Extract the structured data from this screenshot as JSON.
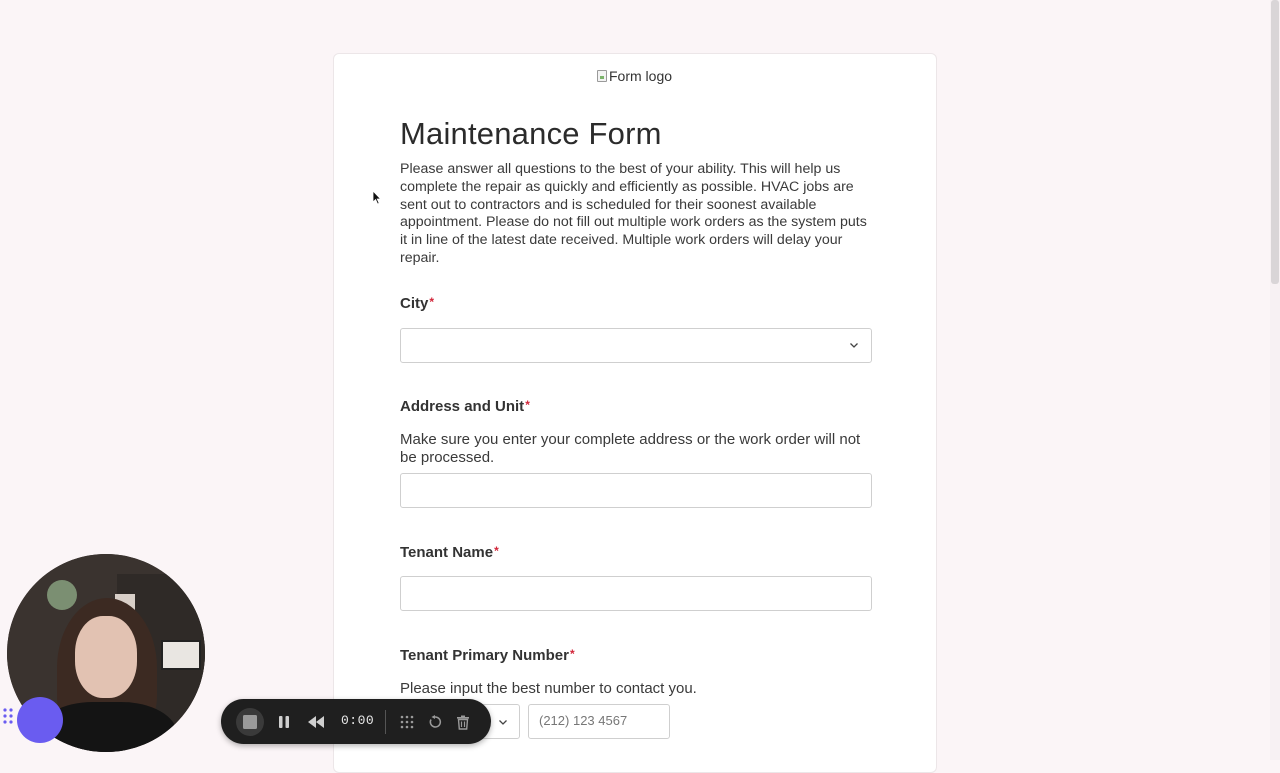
{
  "form": {
    "logo_alt": "Form logo",
    "title": "Maintenance Form",
    "description": "Please answer all questions to the best of your ability. This will help us complete the repair as quickly and efficiently as possible. HVAC jobs are sent out to contractors and is scheduled for their soonest available appointment. Please do not fill out multiple work orders as the system puts it in line of the latest date received. Multiple work orders will delay your repair.",
    "required_mark": "*",
    "fields": {
      "city": {
        "label": "City",
        "value": ""
      },
      "address": {
        "label": "Address and Unit",
        "hint": "Make sure you enter your complete address or the work order will not be processed.",
        "value": ""
      },
      "tenant_name": {
        "label": "Tenant Name",
        "value": ""
      },
      "tenant_phone": {
        "label": "Tenant Primary Number",
        "hint": "Please input the best number to contact you.",
        "placeholder": "(212) 123 4567"
      }
    }
  },
  "recorder": {
    "time": "0:00",
    "icons": [
      "stop-icon",
      "pause-icon",
      "rewind-icon",
      "drag-icon",
      "restart-icon",
      "trash-icon"
    ]
  },
  "colors": {
    "background": "#fbf5f7",
    "required": "#d2263a",
    "recorder_accent": "#6a5cf0",
    "toolbar": "#1f1f1f"
  }
}
